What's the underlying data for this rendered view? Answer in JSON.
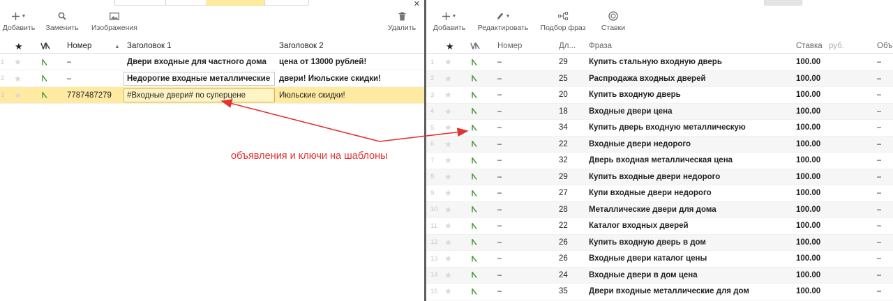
{
  "left": {
    "toolbar": {
      "add": "Добавить",
      "replace": "Заменить",
      "images": "Изображения",
      "delete": "Удалить"
    },
    "columns": [
      "Номер",
      "Заголовок 1",
      "Заголовок 2"
    ],
    "rows": [
      {
        "index": "1",
        "number": "–",
        "title1": "Двери входные для частного дома",
        "title2": "цена от 13000 рублей!"
      },
      {
        "index": "2",
        "number": "–",
        "title1": "Недорогие входные металлические",
        "title2": "двери! Июльские скидки!"
      },
      {
        "index": "3",
        "number": "7787487279",
        "title1": "#Входные двери# по суперцене",
        "title2": "Июльские скидки!"
      }
    ],
    "close": "×"
  },
  "right": {
    "toolbar": {
      "add": "Добавить",
      "edit": "Редактировать",
      "phrases": "Подбор фраз",
      "bids": "Ставки"
    },
    "columns": {
      "number": "Номер",
      "length": "Дл...",
      "phrase": "Фраза",
      "bid": "Ставка",
      "currency": "руб.",
      "more": "Объ"
    },
    "rows": [
      {
        "index": "1",
        "number": "–",
        "length": "29",
        "phrase": "Купить стальную входную дверь",
        "bid": "100.00",
        "extra": "–"
      },
      {
        "index": "2",
        "number": "–",
        "length": "25",
        "phrase": "Распродажа входных дверей",
        "bid": "100.00",
        "extra": "–"
      },
      {
        "index": "3",
        "number": "–",
        "length": "20",
        "phrase": "Купить входную дверь",
        "bid": "100.00",
        "extra": "–"
      },
      {
        "index": "4",
        "number": "–",
        "length": "18",
        "phrase": "Входные двери цена",
        "bid": "100.00",
        "extra": "–"
      },
      {
        "index": "5",
        "number": "–",
        "length": "34",
        "phrase": "Купить дверь входную металлическую",
        "bid": "100.00",
        "extra": "–"
      },
      {
        "index": "6",
        "number": "–",
        "length": "22",
        "phrase": "Входные двери недорого",
        "bid": "100.00",
        "extra": "–"
      },
      {
        "index": "7",
        "number": "–",
        "length": "32",
        "phrase": "Дверь входная металлическая цена",
        "bid": "100.00",
        "extra": "–"
      },
      {
        "index": "8",
        "number": "–",
        "length": "29",
        "phrase": "Купить входные двери недорого",
        "bid": "100.00",
        "extra": "–"
      },
      {
        "index": "9",
        "number": "–",
        "length": "27",
        "phrase": "Купи входные двери недорого",
        "bid": "100.00",
        "extra": "–"
      },
      {
        "index": "10",
        "number": "–",
        "length": "28",
        "phrase": "Металлические двери для дома",
        "bid": "100.00",
        "extra": "–"
      },
      {
        "index": "11",
        "number": "–",
        "length": "22",
        "phrase": "Каталог входных дверей",
        "bid": "100.00",
        "extra": "–"
      },
      {
        "index": "12",
        "number": "–",
        "length": "26",
        "phrase": "Купить входную дверь в дом",
        "bid": "100.00",
        "extra": "–"
      },
      {
        "index": "13",
        "number": "–",
        "length": "26",
        "phrase": "Входные двери каталог цены",
        "bid": "100.00",
        "extra": "–"
      },
      {
        "index": "14",
        "number": "–",
        "length": "24",
        "phrase": "Входные двери в дом цена",
        "bid": "100.00",
        "extra": "–"
      },
      {
        "index": "15",
        "number": "–",
        "length": "35",
        "phrase": "Двери входные металлические для дом",
        "bid": "100.00",
        "extra": "–"
      }
    ]
  },
  "annotation": {
    "text": "объявления и ключи на шаблоны",
    "color": "#e53130"
  },
  "colors": {
    "selected_row": "#ffeaa2",
    "strategy_icon": "#4a9a3a",
    "divider": "#5f5f5f"
  }
}
